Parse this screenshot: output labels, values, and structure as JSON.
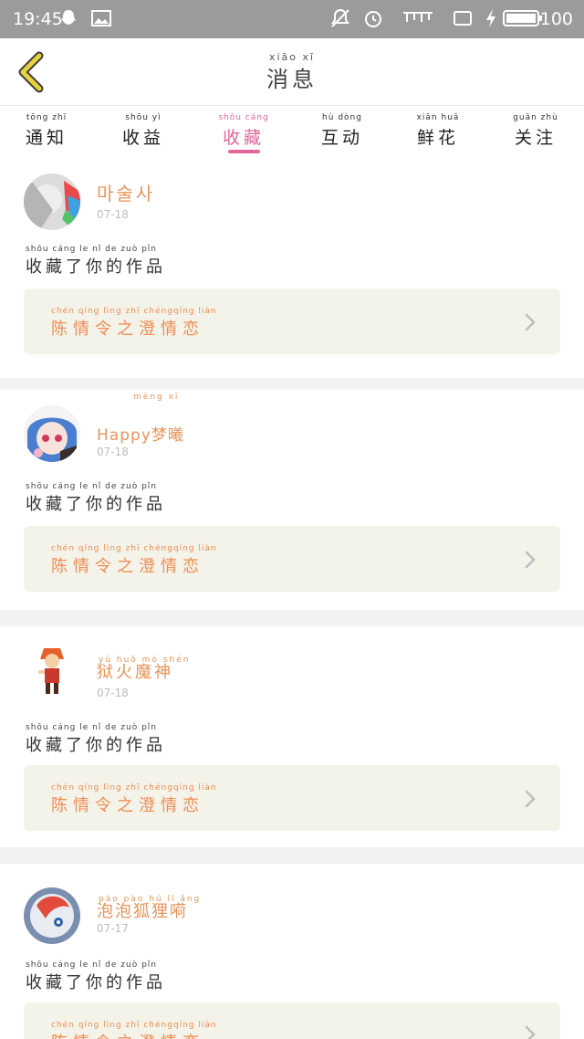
{
  "status_bar": {
    "time": "19:45",
    "battery": "100"
  },
  "header": {
    "title_pinyin": "xiāo xī",
    "title": "消息"
  },
  "tabs": [
    {
      "pinyin": "tōng zhī",
      "label": "通知"
    },
    {
      "pinyin": "shōu yì",
      "label": "收益"
    },
    {
      "pinyin": "shōu cáng",
      "label": "收藏"
    },
    {
      "pinyin": "hù dòng",
      "label": "互动"
    },
    {
      "pinyin": "xiān huā",
      "label": "鲜花"
    },
    {
      "pinyin": "guān zhù",
      "label": "关注"
    }
  ],
  "active_tab": "收藏",
  "messages": [
    {
      "name_pinyin": "",
      "name": "마술사",
      "date": "07-18",
      "msg_pinyin": "shōu cáng   le   nǐ   de  zuò  pǐn",
      "msg": "收藏了你的作品",
      "work_pinyin": "chén qíng lìng  zhī chéngqíng liàn",
      "work": "陈情令之澄情恋"
    },
    {
      "name_pinyin": "mèng xī",
      "name": "Happy梦曦",
      "date": "07-18",
      "msg_pinyin": "shōu cáng   le   nǐ   de  zuò  pǐn",
      "msg": "收藏了你的作品",
      "work_pinyin": "chén qíng lìng  zhī chéngqíng liàn",
      "work": "陈情令之澄情恋"
    },
    {
      "name_pinyin": "yù  huǒ  mó  shén",
      "name": "狱火魔神",
      "date": "07-18",
      "msg_pinyin": "shōu cáng   le   nǐ   de  zuò  pǐn",
      "msg": "收藏了你的作品",
      "work_pinyin": "chén qíng lìng  zhī chéngqíng liàn",
      "work": "陈情令之澄情恋"
    },
    {
      "name_pinyin": "pào pào  hú   lí   ǎng",
      "name": "泡泡狐狸嗬",
      "date": "07-17",
      "msg_pinyin": "shōu cáng   le   nǐ   de  zuò  pǐn",
      "msg": "收藏了你的作品",
      "work_pinyin": "chén qíng lìng  zhī chéngqíng liàn",
      "work": "陈情令之澄情恋"
    }
  ],
  "colors": {
    "accent": "#e0679a",
    "orange": "#f08c52",
    "back_arrow": "#e6d23c"
  },
  "icons": [
    "mute-icon",
    "alarm-icon",
    "notification-icon",
    "screen-icon",
    "charging-icon",
    "battery-icon",
    "back-arrow-icon",
    "chevron-right-icon"
  ]
}
